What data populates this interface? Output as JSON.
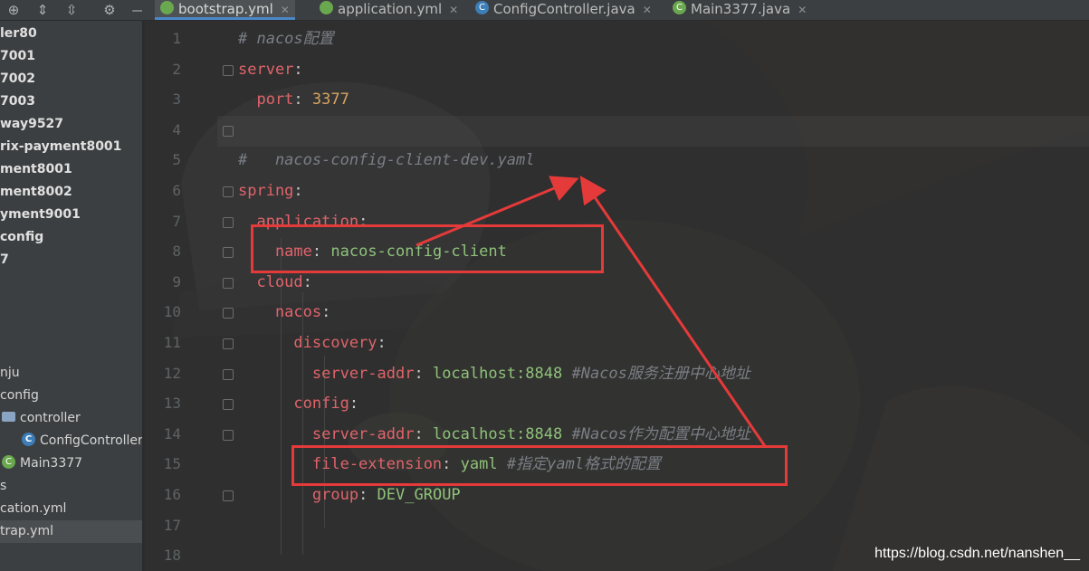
{
  "tabs": [
    {
      "label": "bootstrap.yml",
      "icon": "yaml-file-icon",
      "active": true
    },
    {
      "label": "application.yml",
      "icon": "yaml-file-icon",
      "active": false
    },
    {
      "label": "ConfigController.java",
      "icon": "java-class-icon",
      "active": false
    },
    {
      "label": "Main3377.java",
      "icon": "spring-boot-class-icon",
      "active": false
    }
  ],
  "tab_close_glyph": "✕",
  "sidebar": {
    "toolbar_icons": [
      "locate-icon",
      "expand-all-icon",
      "collapse-all-icon",
      "settings-icon",
      "hide-icon"
    ],
    "items": [
      {
        "label": "ler80",
        "bold": true
      },
      {
        "label": "7001",
        "bold": true
      },
      {
        "label": "7002",
        "bold": true
      },
      {
        "label": "7003",
        "bold": true
      },
      {
        "label": "way9527",
        "bold": true
      },
      {
        "label": "rix-payment8001",
        "bold": true
      },
      {
        "label": "ment8001",
        "bold": true
      },
      {
        "label": "ment8002",
        "bold": true
      },
      {
        "label": "yment9001",
        "bold": true
      },
      {
        "label": "config",
        "bold": true
      },
      {
        "label": "7",
        "bold": true
      },
      {
        "label": "nju",
        "bold": false
      },
      {
        "label": "config",
        "bold": false
      },
      {
        "label": "controller",
        "bold": false,
        "icon": "folder-icon"
      },
      {
        "label": "ConfigController",
        "bold": false,
        "icon": "java-class-icon"
      },
      {
        "label": "Main3377",
        "bold": false,
        "icon": "spring-boot-class-icon"
      },
      {
        "label": "s",
        "bold": false
      },
      {
        "label": "cation.yml",
        "bold": false
      },
      {
        "label": "trap.yml",
        "bold": false,
        "selected": true
      }
    ]
  },
  "editor": {
    "line_numbers": [
      "1",
      "2",
      "3",
      "4",
      "5",
      "6",
      "7",
      "8",
      "9",
      "10",
      "11",
      "12",
      "13",
      "14",
      "15",
      "16",
      "17",
      "18"
    ],
    "lines": [
      [
        {
          "t": "# nacos配置",
          "c": "c"
        }
      ],
      [
        {
          "t": "server",
          "c": "k"
        },
        {
          "t": ":",
          "c": "p"
        }
      ],
      [
        {
          "t": "  port",
          "c": "k"
        },
        {
          "t": ": ",
          "c": "p"
        },
        {
          "t": "3377",
          "c": "n"
        }
      ],
      [],
      [
        {
          "t": "#   nacos-config-client-dev.yaml",
          "c": "c"
        }
      ],
      [
        {
          "t": "spring",
          "c": "k"
        },
        {
          "t": ":",
          "c": "p"
        }
      ],
      [
        {
          "t": "  application",
          "c": "k"
        },
        {
          "t": ":",
          "c": "p"
        }
      ],
      [
        {
          "t": "    name",
          "c": "k"
        },
        {
          "t": ": ",
          "c": "p"
        },
        {
          "t": "nacos-config-client",
          "c": "s"
        }
      ],
      [
        {
          "t": "  cloud",
          "c": "k"
        },
        {
          "t": ":",
          "c": "p"
        }
      ],
      [
        {
          "t": "    nacos",
          "c": "k"
        },
        {
          "t": ":",
          "c": "p"
        }
      ],
      [
        {
          "t": "      discovery",
          "c": "k"
        },
        {
          "t": ":",
          "c": "p"
        }
      ],
      [
        {
          "t": "        server-addr",
          "c": "k"
        },
        {
          "t": ": ",
          "c": "p"
        },
        {
          "t": "localhost:8848",
          "c": "s"
        },
        {
          "t": " #Nacos服务注册中心地址",
          "c": "c"
        }
      ],
      [
        {
          "t": "      config",
          "c": "k"
        },
        {
          "t": ":",
          "c": "p"
        }
      ],
      [
        {
          "t": "        server-addr",
          "c": "k"
        },
        {
          "t": ": ",
          "c": "p"
        },
        {
          "t": "localhost:8848",
          "c": "s"
        },
        {
          "t": " #Nacos作为配置中心地址",
          "c": "c"
        }
      ],
      [
        {
          "t": "        file-extension",
          "c": "k"
        },
        {
          "t": ": ",
          "c": "p"
        },
        {
          "t": "yaml",
          "c": "s"
        },
        {
          "t": " #指定yaml格式的配置",
          "c": "c"
        }
      ],
      [
        {
          "t": "        group",
          "c": "k"
        },
        {
          "t": ": ",
          "c": "p"
        },
        {
          "t": "DEV_GROUP",
          "c": "s"
        }
      ],
      [],
      []
    ]
  },
  "annotation_color": "#e53a3a",
  "watermark": "https://blog.csdn.net/nanshen__"
}
